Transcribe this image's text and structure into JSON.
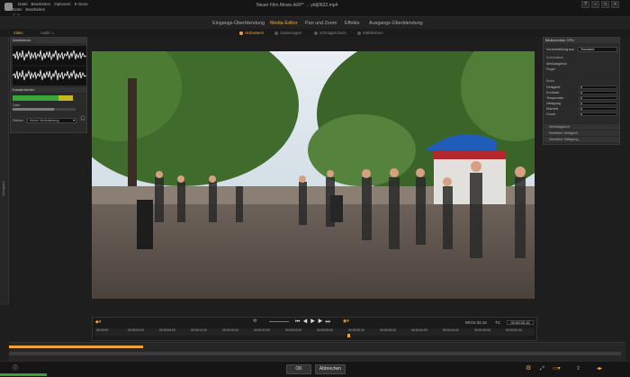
{
  "titlebar": {
    "menu_row1": [
      "Datei",
      "Bearbeiten",
      "Optionen",
      "E-Store"
    ],
    "menu_row2": [
      "Datei",
      "Bearbeiten"
    ],
    "file_title": "Neuer Film.Movie.AXP* → ytdj0622.mp4",
    "window_buttons": [
      "?",
      "–",
      "□",
      "×"
    ]
  },
  "tabs": [
    {
      "label": "Eingangs-Überblendung",
      "active": false
    },
    {
      "label": "Media-Editor",
      "active": true
    },
    {
      "label": "Pan und Zoom",
      "active": false
    },
    {
      "label": "Effekte",
      "active": false
    },
    {
      "label": "Ausgangs-Überblendung",
      "active": false
    }
  ],
  "media_tabs": {
    "video": "Video",
    "audio": "Audio"
  },
  "subtabs": [
    {
      "label": "Verbessern",
      "active": true
    },
    {
      "label": "Justierungen",
      "active": false
    },
    {
      "label": "Schnappschuss",
      "active": false
    },
    {
      "label": "Stabilisieren",
      "active": false
    }
  ],
  "left_strip": {
    "label": "Navigator"
  },
  "audio_panel": {
    "waveform_title": "Wellenform",
    "channel_title": "Kanalmischer",
    "gain_label": "Gain",
    "stereo_label": "Stereo",
    "stereo_value": "Keine Veränderung"
  },
  "right_panel": {
    "title": "Bildkorrektur CPU",
    "preset_label": "Voreinstellung aus",
    "preset_value": "Standard",
    "automation_heading": "Automation",
    "white_balance": "Weißabgleich",
    "level": "Pegel",
    "basics_heading": "Basis",
    "sliders": [
      "Helligkeit",
      "Kontrast",
      "Temperatur",
      "Sättigung",
      "Klarheit",
      "Dunst"
    ],
    "accordion": [
      "Weißabgleich",
      "Selektive Helligkeit",
      "Selektive Sättigung"
    ]
  },
  "transport": {
    "timecode_left": "00:01:33.16",
    "timecode_prefix": "TC",
    "timecode_right": "00:00:33.16",
    "ruler_labels": [
      "00:00:00",
      "00:00:04.00",
      "00:00:08.00",
      "00:00:12.00",
      "00:00:16.00",
      "00:00:20.00",
      "00:00:24.00",
      "00:00:28.00",
      "00:00:32.00",
      "00:00:36.00",
      "00:00:40.00",
      "00:00:44.00",
      "00:00:48.00",
      "00:00:52.00"
    ]
  },
  "timeline": {
    "progress": 0.22
  },
  "bottom": {
    "ok": "OK",
    "cancel": "Abbrechen"
  },
  "colors": {
    "accent": "#f2a43a",
    "panel": "#2a2a2a",
    "meter_green": "#37a53a"
  }
}
